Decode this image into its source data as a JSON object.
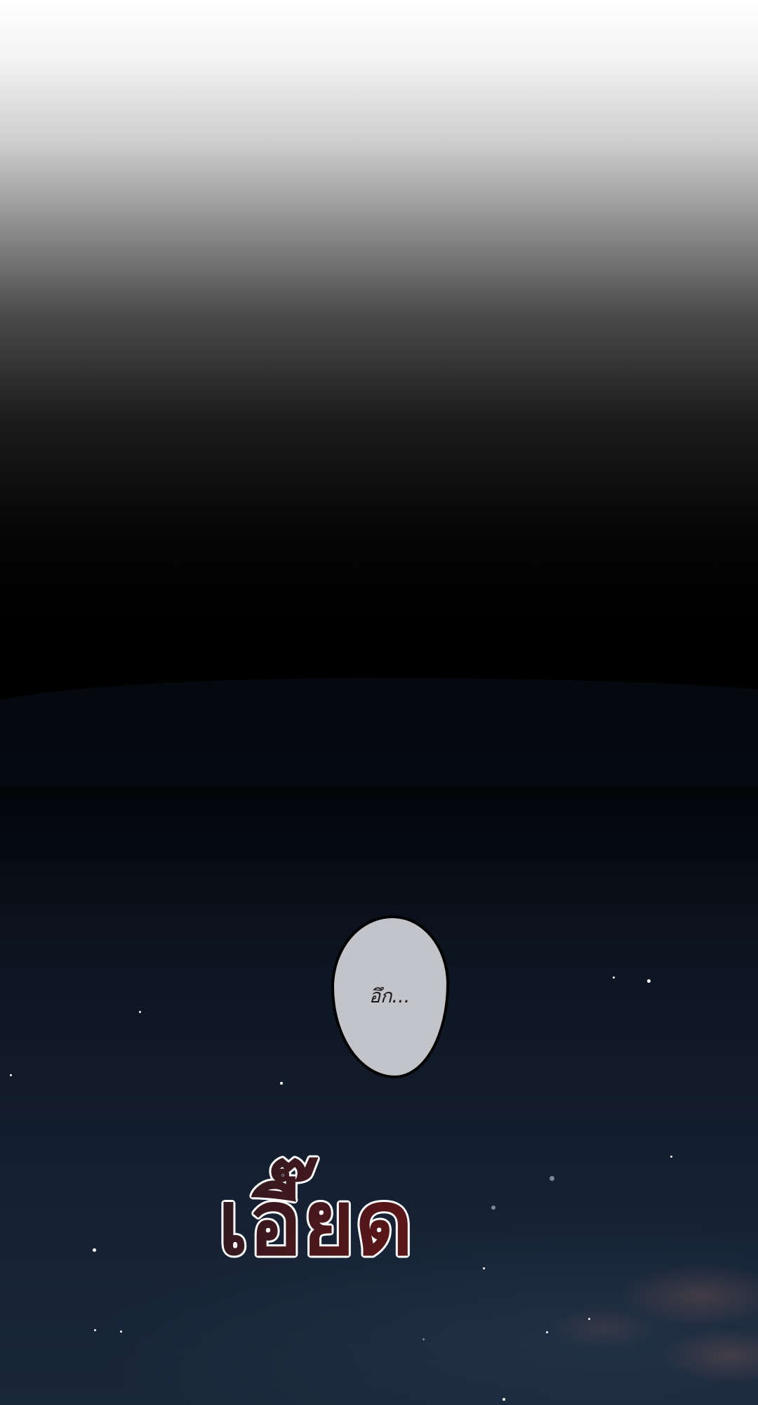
{
  "panel": {
    "speech_bubble": {
      "text": "อึก..."
    },
    "sound_effect": {
      "text": "เอี๊ยด",
      "fill_color": "#4a1416",
      "outline_color": "#ffffff"
    },
    "colors": {
      "sky_top": "#ffffff",
      "sky_mid": "#000000",
      "night_sky": "#162234",
      "bubble": "#c3c4c9"
    }
  }
}
